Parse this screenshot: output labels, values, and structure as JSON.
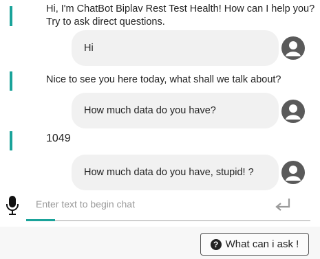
{
  "messages": [
    {
      "from": "bot",
      "lines": [
        "Hi, I'm ChatBot Biplav Rest Test Health! How can I help you?",
        "Try to ask direct questions."
      ]
    },
    {
      "from": "user",
      "text": "Hi"
    },
    {
      "from": "bot",
      "lines": [
        "Nice to see you here today, what shall we talk about?"
      ]
    },
    {
      "from": "user",
      "text": "How much data do you have?"
    },
    {
      "from": "bot",
      "lines": [
        "1049"
      ]
    },
    {
      "from": "user",
      "text": "How much data do you have, stupid! ?"
    }
  ],
  "input": {
    "placeholder": "Enter text to begin chat",
    "value": ""
  },
  "help_button": {
    "label": "What can i ask !",
    "icon": "question-circle-icon"
  },
  "colors": {
    "accent": "#1aa39a",
    "bubble": "#f1f1f1",
    "avatar": "#5a5a5a"
  }
}
